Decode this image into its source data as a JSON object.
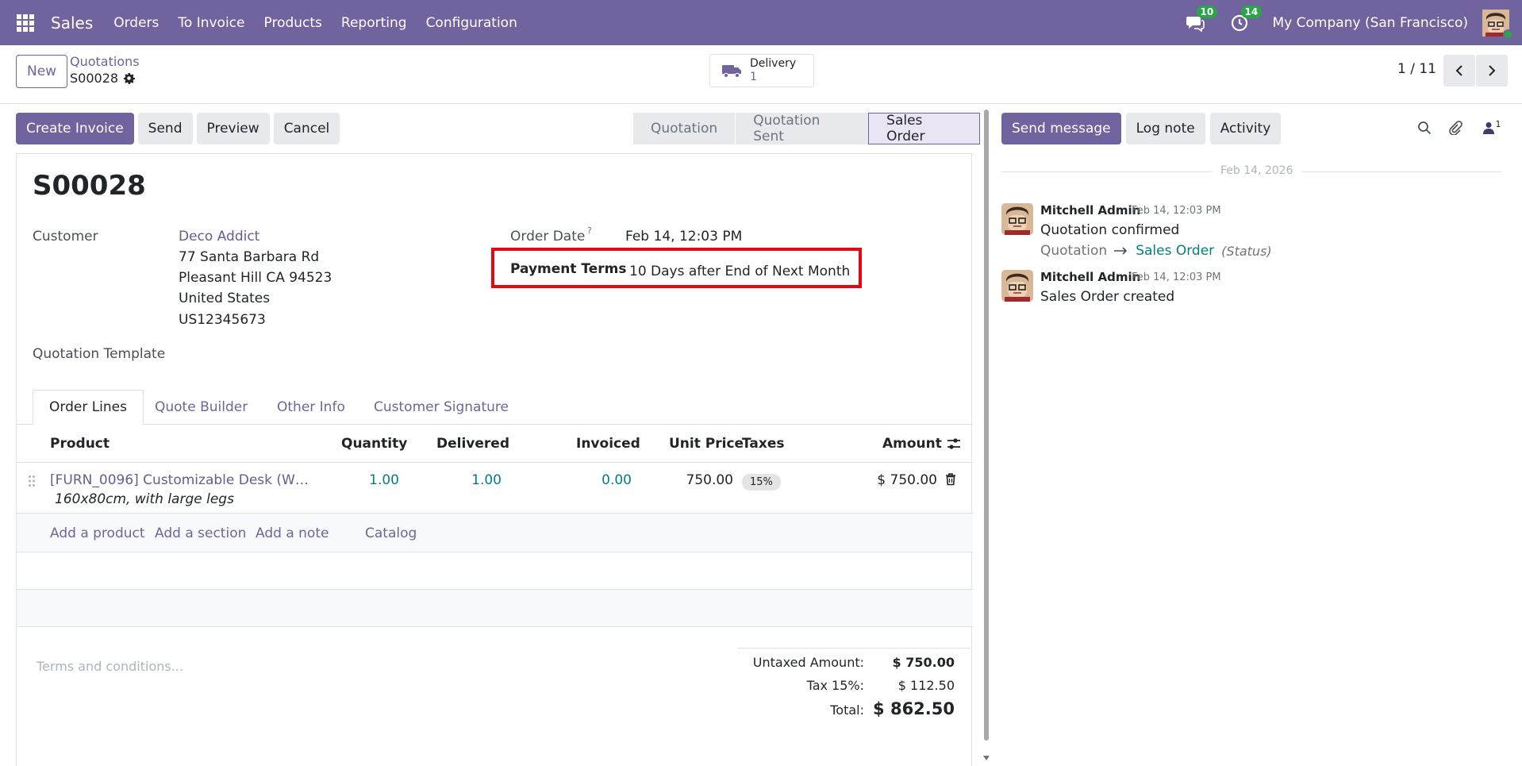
{
  "topnav": {
    "app_name": "Sales",
    "menu": [
      "Orders",
      "To Invoice",
      "Products",
      "Reporting",
      "Configuration"
    ],
    "messages_count": "10",
    "activities_count": "14",
    "company": "My Company (San Francisco)"
  },
  "control_panel": {
    "new_label": "New",
    "breadcrumb_parent": "Quotations",
    "breadcrumb_current": "S00028",
    "delivery_label": "Delivery",
    "delivery_count": "1",
    "pager": "1 / 11"
  },
  "statusbar": {
    "buttons": [
      "Create Invoice",
      "Send",
      "Preview",
      "Cancel"
    ],
    "stages": [
      "Quotation",
      "Quotation Sent",
      "Sales Order"
    ],
    "active_stage": "Sales Order"
  },
  "form": {
    "name": "S00028",
    "customer_label": "Customer",
    "customer_name": "Deco Addict",
    "address": [
      "77 Santa Barbara Rd",
      "Pleasant Hill CA 94523",
      "United States",
      "US12345673"
    ],
    "order_date_label": "Order Date",
    "order_date_help": "?",
    "order_date": "Feb 14, 12:03 PM",
    "payment_terms_label": "Payment Terms",
    "payment_terms": "10 Days after End of Next Month",
    "quotation_template_label": "Quotation Template"
  },
  "tabs": [
    "Order Lines",
    "Quote Builder",
    "Other Info",
    "Customer Signature"
  ],
  "table": {
    "headers": {
      "product": "Product",
      "quantity": "Quantity",
      "delivered": "Delivered",
      "invoiced": "Invoiced",
      "unit_price": "Unit Price",
      "taxes": "Taxes",
      "amount": "Amount"
    },
    "rows": [
      {
        "product": "[FURN_0096] Customizable Desk (W…",
        "description": "160x80cm, with large legs",
        "quantity": "1.00",
        "delivered": "1.00",
        "invoiced": "0.00",
        "unit_price": "750.00",
        "tax": "15%",
        "amount": "$ 750.00"
      }
    ],
    "add_links": [
      "Add a product",
      "Add a section",
      "Add a note",
      "Catalog"
    ]
  },
  "footer": {
    "terms_placeholder": "Terms and conditions...",
    "untaxed_label": "Untaxed Amount:",
    "untaxed_value": "$ 750.00",
    "tax_label": "Tax 15%:",
    "tax_value": "$ 112.50",
    "total_label": "Total:",
    "total_value": "$ 862.50"
  },
  "chatter": {
    "buttons": [
      "Send message",
      "Log note",
      "Activity"
    ],
    "followers_count": "1",
    "date": "Feb 14, 2026",
    "messages": [
      {
        "author": "Mitchell Admin",
        "time": "Feb 14, 12:03 PM",
        "body": "Quotation confirmed",
        "tracking_old": "Quotation",
        "tracking_new": "Sales Order",
        "tracking_field": "(Status)"
      },
      {
        "author": "Mitchell Admin",
        "time": "Feb 14, 12:03 PM",
        "body": "Sales Order created"
      }
    ]
  },
  "colors": {
    "brand": "#71639e",
    "link_teal": "#017e84",
    "badge_green": "#28a745",
    "highlight_red": "#e30613"
  },
  "icons": [
    "apps-grid-icon",
    "chat-icon",
    "clock-icon",
    "gear-icon",
    "truck-icon",
    "chevron-left-icon",
    "chevron-right-icon",
    "drag-handle-icon",
    "trash-icon",
    "settings-sliders-icon",
    "search-icon",
    "paperclip-icon",
    "user-icon",
    "arrow-right-icon"
  ]
}
